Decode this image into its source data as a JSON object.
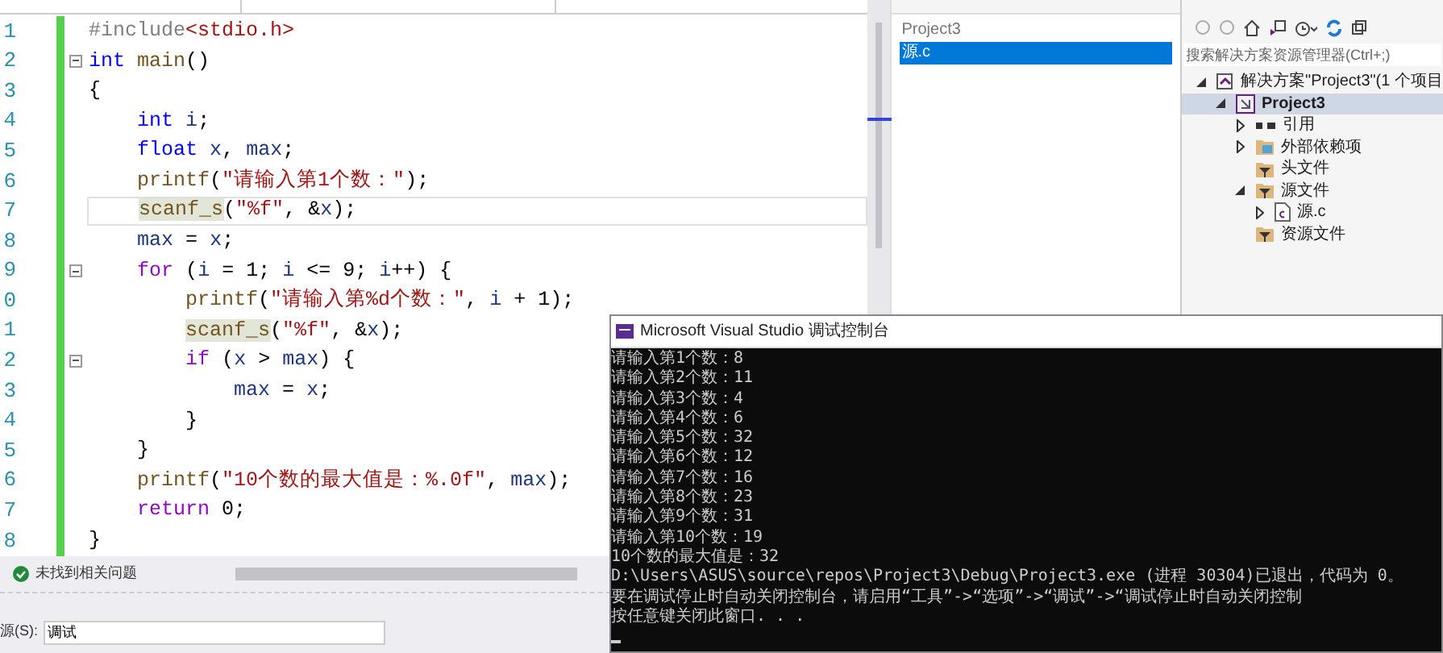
{
  "editor": {
    "lines": [
      {
        "number": "1",
        "fold": false,
        "current": false,
        "tokens": [
          {
            "kind": "pp",
            "text": "#include"
          },
          {
            "kind": "str",
            "text": "<stdio.h>"
          }
        ]
      },
      {
        "number": "2",
        "fold": true,
        "current": false,
        "tokens": [
          {
            "kind": "kw",
            "text": "int"
          },
          {
            "kind": "fn",
            "text": " main"
          },
          {
            "kind": "plain",
            "text": "()"
          }
        ]
      },
      {
        "number": "3",
        "fold": false,
        "current": false,
        "tokens": [
          {
            "kind": "plain",
            "text": "{"
          }
        ]
      },
      {
        "number": "4",
        "fold": false,
        "current": false,
        "tokens": [
          {
            "kind": "kw",
            "text": "    int"
          },
          {
            "kind": "var",
            "text": " i"
          },
          {
            "kind": "plain",
            "text": ";"
          }
        ]
      },
      {
        "number": "5",
        "fold": false,
        "current": false,
        "tokens": [
          {
            "kind": "kw",
            "text": "    float"
          },
          {
            "kind": "var",
            "text": " x"
          },
          {
            "kind": "plain",
            "text": ", "
          },
          {
            "kind": "var",
            "text": "max"
          },
          {
            "kind": "plain",
            "text": ";"
          }
        ]
      },
      {
        "number": "6",
        "fold": false,
        "current": false,
        "tokens": [
          {
            "kind": "fn",
            "text": "    printf"
          },
          {
            "kind": "plain",
            "text": "("
          },
          {
            "kind": "str",
            "text": "\"请输入第1个数：\""
          },
          {
            "kind": "plain",
            "text": ");"
          }
        ]
      },
      {
        "number": "7",
        "fold": false,
        "current": true,
        "tokens": [
          {
            "kind": "fnhl",
            "text": "    scanf_s"
          },
          {
            "kind": "plain",
            "text": "("
          },
          {
            "kind": "str",
            "text": "\"%f\""
          },
          {
            "kind": "plain",
            "text": ", &"
          },
          {
            "kind": "var",
            "text": "x"
          },
          {
            "kind": "plain",
            "text": ");"
          }
        ]
      },
      {
        "number": "8",
        "fold": false,
        "current": false,
        "tokens": [
          {
            "kind": "var",
            "text": "    max"
          },
          {
            "kind": "plain",
            "text": " = "
          },
          {
            "kind": "var",
            "text": "x"
          },
          {
            "kind": "plain",
            "text": ";"
          }
        ]
      },
      {
        "number": "9",
        "fold": true,
        "current": false,
        "tokens": [
          {
            "kind": "ctl",
            "text": "    for"
          },
          {
            "kind": "plain",
            "text": " ("
          },
          {
            "kind": "var",
            "text": "i"
          },
          {
            "kind": "plain",
            "text": " = 1; "
          },
          {
            "kind": "var",
            "text": "i"
          },
          {
            "kind": "plain",
            "text": " <= 9; "
          },
          {
            "kind": "var",
            "text": "i"
          },
          {
            "kind": "plain",
            "text": "++) {"
          }
        ]
      },
      {
        "number": "0",
        "fold": false,
        "current": false,
        "tokens": [
          {
            "kind": "fn",
            "text": "        printf"
          },
          {
            "kind": "plain",
            "text": "("
          },
          {
            "kind": "str",
            "text": "\"请输入第%d个数：\""
          },
          {
            "kind": "plain",
            "text": ", "
          },
          {
            "kind": "var",
            "text": "i"
          },
          {
            "kind": "plain",
            "text": " + 1);"
          }
        ]
      },
      {
        "number": "1",
        "fold": false,
        "current": false,
        "tokens": [
          {
            "kind": "fnhl",
            "text": "        scanf_s"
          },
          {
            "kind": "plain",
            "text": "("
          },
          {
            "kind": "str",
            "text": "\"%f\""
          },
          {
            "kind": "plain",
            "text": ", &"
          },
          {
            "kind": "var",
            "text": "x"
          },
          {
            "kind": "plain",
            "text": ");"
          }
        ]
      },
      {
        "number": "2",
        "fold": true,
        "current": false,
        "tokens": [
          {
            "kind": "ctl",
            "text": "        if"
          },
          {
            "kind": "plain",
            "text": " ("
          },
          {
            "kind": "var",
            "text": "x"
          },
          {
            "kind": "plain",
            "text": " > "
          },
          {
            "kind": "var",
            "text": "max"
          },
          {
            "kind": "plain",
            "text": ") {"
          }
        ]
      },
      {
        "number": "3",
        "fold": false,
        "current": false,
        "tokens": [
          {
            "kind": "var",
            "text": "            max"
          },
          {
            "kind": "plain",
            "text": " = "
          },
          {
            "kind": "var",
            "text": "x"
          },
          {
            "kind": "plain",
            "text": ";"
          }
        ]
      },
      {
        "number": "4",
        "fold": false,
        "current": false,
        "tokens": [
          {
            "kind": "plain",
            "text": "        }"
          }
        ]
      },
      {
        "number": "5",
        "fold": false,
        "current": false,
        "tokens": [
          {
            "kind": "plain",
            "text": "    }"
          }
        ]
      },
      {
        "number": "6",
        "fold": false,
        "current": false,
        "tokens": [
          {
            "kind": "fn",
            "text": "    printf"
          },
          {
            "kind": "plain",
            "text": "("
          },
          {
            "kind": "str",
            "text": "\"10个数的最大值是：%.0f\""
          },
          {
            "kind": "plain",
            "text": ", "
          },
          {
            "kind": "var",
            "text": "max"
          },
          {
            "kind": "plain",
            "text": ");"
          }
        ]
      },
      {
        "number": "7",
        "fold": false,
        "current": false,
        "tokens": [
          {
            "kind": "ctl",
            "text": "    return"
          },
          {
            "kind": "plain",
            "text": " 0;"
          }
        ]
      },
      {
        "number": "8",
        "fold": false,
        "current": false,
        "tokens": [
          {
            "kind": "plain",
            "text": "}"
          }
        ]
      }
    ],
    "status": "未找到相关问题"
  },
  "output": {
    "source_label": "源(S):",
    "source_value": "调试"
  },
  "file_list": {
    "items": [
      {
        "label": "Project3",
        "selected": false
      },
      {
        "label": "源.c",
        "selected": true
      }
    ]
  },
  "solution_explorer": {
    "search": {
      "placeholder": "搜索解决方案资源管理器(Ctrl+;)"
    },
    "tree": [
      {
        "label": "解决方案\"Project3\"(1 个项目",
        "kind": "solution",
        "selected": false,
        "expanded": true,
        "children": [
          {
            "label": "Project3",
            "kind": "project",
            "selected": true,
            "expanded": true,
            "children": [
              {
                "label": "引用",
                "kind": "refs",
                "selected": false,
                "expanded": false
              },
              {
                "label": "外部依赖项",
                "kind": "deps",
                "selected": false,
                "expanded": false
              },
              {
                "label": "头文件",
                "kind": "filter",
                "selected": false
              },
              {
                "label": "源文件",
                "kind": "filter",
                "selected": false,
                "expanded": true,
                "children": [
                  {
                    "label": "源.c",
                    "kind": "file",
                    "selected": false,
                    "expanded": false
                  }
                ]
              },
              {
                "label": "资源文件",
                "kind": "filter",
                "selected": false
              }
            ]
          }
        ]
      }
    ]
  },
  "console": {
    "title": "Microsoft Visual Studio 调试控制台",
    "lines": [
      "请输入第1个数：8",
      "请输入第2个数：11",
      "请输入第3个数：4",
      "请输入第4个数：6",
      "请输入第5个数：32",
      "请输入第6个数：12",
      "请输入第7个数：16",
      "请输入第8个数：23",
      "请输入第9个数：31",
      "请输入第10个数：19",
      "10个数的最大值是：32",
      "D:\\Users\\ASUS\\source\\repos\\Project3\\Debug\\Project3.exe (进程 30304)已退出，代码为 0。",
      "要在调试停止时自动关闭控制台，请启用“工具”->“选项”->“调试”->“调试停止时自动关闭控制",
      "按任意键关闭此窗口. . ."
    ]
  }
}
